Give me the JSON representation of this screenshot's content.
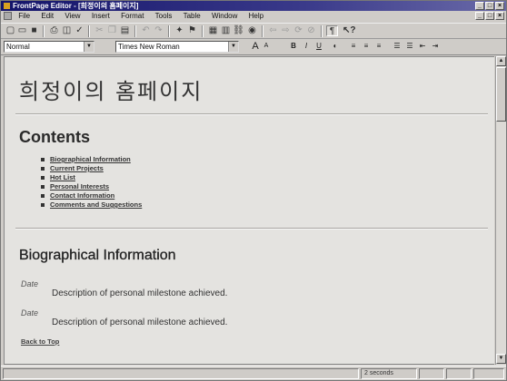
{
  "window": {
    "title": "FrontPage Editor - [희정이의 홈페이지]",
    "controls": [
      "_",
      "□",
      "×"
    ]
  },
  "menubar": {
    "items": [
      "File",
      "Edit",
      "View",
      "Insert",
      "Format",
      "Tools",
      "Table",
      "Window",
      "Help"
    ]
  },
  "toolbar": {
    "standard_icons": [
      "new-icon",
      "open-icon",
      "save-icon",
      "print-icon",
      "print-preview-icon",
      "spelling-icon",
      "cut-icon",
      "copy-icon",
      "paste-icon",
      "undo-icon",
      "redo-icon",
      "webbot-icon",
      "form-field-icon",
      "table-icon",
      "image-icon",
      "link-icon",
      "back-icon",
      "forward-icon",
      "refresh-icon",
      "stop-icon",
      "show-paragraph-icon",
      "help-icon"
    ]
  },
  "format_toolbar": {
    "style_value": "Normal",
    "font_value": "Times New Roman",
    "buttons": [
      "A",
      "A",
      "B",
      "I",
      "U"
    ]
  },
  "document": {
    "title": "희정이의 홈페이지",
    "contents_heading": "Contents",
    "contents_links": [
      "Biographical Information",
      "Current Projects",
      "Hot List",
      "Personal Interests",
      "Contact Information",
      "Comments and Suggestions"
    ],
    "bio_heading": "Biographical Information",
    "entries": [
      {
        "date": "Date",
        "description": "Description of personal milestone achieved."
      },
      {
        "date": "Date",
        "description": "Description of personal milestone achieved."
      }
    ],
    "back_to_top": "Back to Top"
  },
  "status": {
    "load_time": "2 seconds"
  },
  "colors": {
    "titlebar": "#14146a",
    "document_bg": "#e4e3e0",
    "chrome": "#cfccc8"
  }
}
